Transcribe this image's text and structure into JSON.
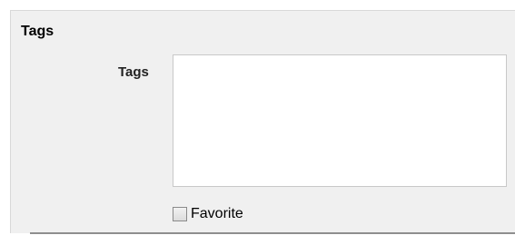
{
  "section": {
    "title": "Tags"
  },
  "tags_field": {
    "label": "Tags",
    "value": ""
  },
  "favorite": {
    "label": "Favorite",
    "checked": false
  }
}
